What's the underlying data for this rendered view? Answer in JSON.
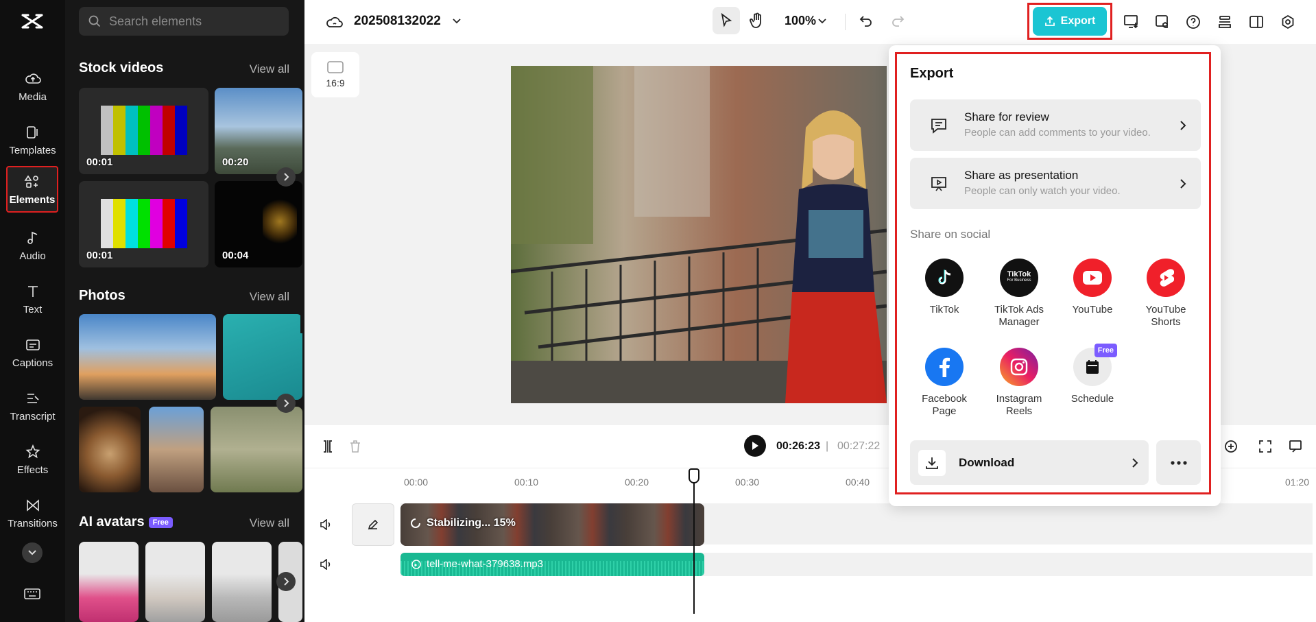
{
  "rail": {
    "items": [
      {
        "label": "Media",
        "icon": "cloud-upload-icon"
      },
      {
        "label": "Templates",
        "icon": "templates-icon"
      },
      {
        "label": "Elements",
        "icon": "elements-icon"
      },
      {
        "label": "Audio",
        "icon": "music-note-icon"
      },
      {
        "label": "Text",
        "icon": "text-icon"
      },
      {
        "label": "Captions",
        "icon": "captions-icon"
      },
      {
        "label": "Transcript",
        "icon": "transcript-icon"
      },
      {
        "label": "Effects",
        "icon": "effects-icon"
      },
      {
        "label": "Transitions",
        "icon": "transitions-icon"
      }
    ]
  },
  "panel": {
    "search_placeholder": "Search elements",
    "stock_videos": {
      "title": "Stock videos",
      "view_all": "View all",
      "durations": [
        "00:01",
        "00:20",
        "00:01",
        "00:04"
      ]
    },
    "photos": {
      "title": "Photos",
      "view_all": "View all"
    },
    "ai_avatars": {
      "title": "AI avatars",
      "badge": "Free",
      "view_all": "View all"
    }
  },
  "topbar": {
    "project_name": "202508132022",
    "zoom": "100%",
    "export_label": "Export"
  },
  "stage": {
    "ratio": "16:9"
  },
  "timeline": {
    "current_time": "00:26:23",
    "separator": "|",
    "total_time": "00:27:22",
    "ticks": [
      "00:00",
      "00:10",
      "00:20",
      "00:30",
      "00:40",
      "01:20"
    ],
    "video_clip_status": "Stabilizing... 15%",
    "audio_clip_name": "tell-me-what-379638.mp3"
  },
  "export_menu": {
    "title": "Export",
    "share_review": {
      "title": "Share for review",
      "subtitle": "People can add comments to your video."
    },
    "share_presentation": {
      "title": "Share as presentation",
      "subtitle": "People can only watch your video."
    },
    "social_heading": "Share on social",
    "social": {
      "tiktok": "TikTok",
      "tiktok_ads_1": "TikTok Ads",
      "tiktok_ads_2": "Manager",
      "tiktok_logo": "TikTok",
      "tiktok_logo_sub": "For Business",
      "youtube": "YouTube",
      "yt_shorts_1": "YouTube",
      "yt_shorts_2": "Shorts",
      "fb_1": "Facebook",
      "fb_2": "Page",
      "ig_1": "Instagram",
      "ig_2": "Reels",
      "schedule": "Schedule",
      "schedule_badge": "Free"
    },
    "download_label": "Download"
  },
  "colors": {
    "accent": "#1bc5d3",
    "highlight": "#e02020",
    "audio_clip": "#19b892"
  }
}
